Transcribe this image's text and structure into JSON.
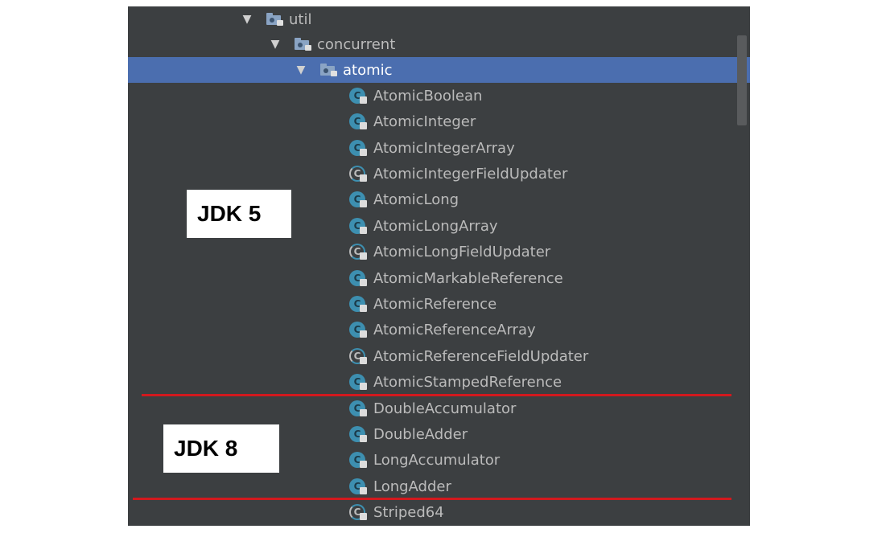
{
  "tree": {
    "packages": [
      {
        "name": "util",
        "level": 0
      },
      {
        "name": "concurrent",
        "level": 1
      },
      {
        "name": "atomic",
        "level": 2,
        "selected": true
      }
    ],
    "classes": [
      {
        "name": "AtomicBoolean",
        "kind": "class"
      },
      {
        "name": "AtomicInteger",
        "kind": "class"
      },
      {
        "name": "AtomicIntegerArray",
        "kind": "class"
      },
      {
        "name": "AtomicIntegerFieldUpdater",
        "kind": "abstract"
      },
      {
        "name": "AtomicLong",
        "kind": "class"
      },
      {
        "name": "AtomicLongArray",
        "kind": "class"
      },
      {
        "name": "AtomicLongFieldUpdater",
        "kind": "abstract"
      },
      {
        "name": "AtomicMarkableReference",
        "kind": "class"
      },
      {
        "name": "AtomicReference",
        "kind": "class"
      },
      {
        "name": "AtomicReferenceArray",
        "kind": "class"
      },
      {
        "name": "AtomicReferenceFieldUpdater",
        "kind": "abstract"
      },
      {
        "name": "AtomicStampedReference",
        "kind": "class"
      },
      {
        "name": "DoubleAccumulator",
        "kind": "class"
      },
      {
        "name": "DoubleAdder",
        "kind": "class"
      },
      {
        "name": "LongAccumulator",
        "kind": "class"
      },
      {
        "name": "LongAdder",
        "kind": "class"
      },
      {
        "name": "Striped64",
        "kind": "abstract"
      }
    ],
    "expand_glyph": "▼",
    "class_glyph": "C"
  },
  "annotations": {
    "jdk5_label": "JDK 5",
    "jdk8_label": "JDK 8"
  },
  "colors": {
    "panel_bg": "#3c3f41",
    "selection": "#4b6eaf",
    "separator": "#d2191e"
  }
}
